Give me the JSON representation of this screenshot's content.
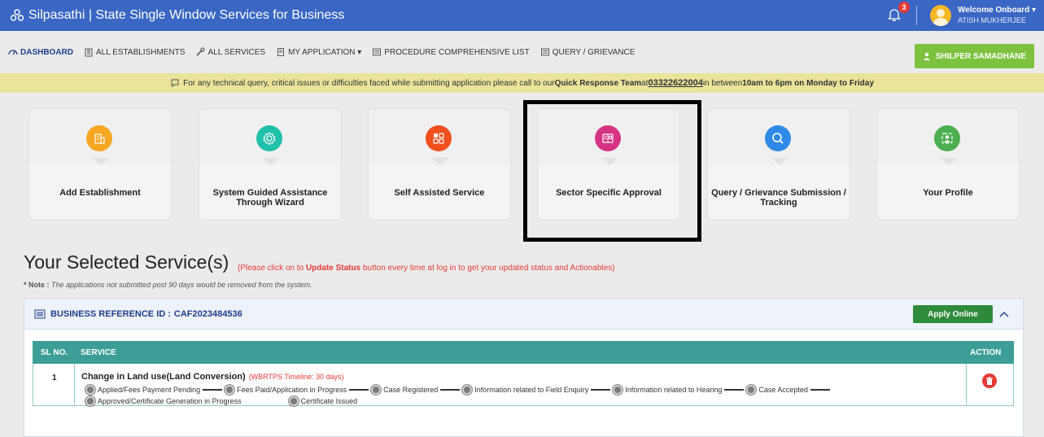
{
  "header": {
    "title": "Silpasathi | State Single Window Services for Business",
    "notification_count": "3",
    "welcome": "Welcome Onboard",
    "user_name": "ATISH MUKHERJEE"
  },
  "nav": {
    "items": [
      {
        "label": "DASHBOARD",
        "icon": "dashboard-icon"
      },
      {
        "label": "ALL ESTABLISHMENTS",
        "icon": "building-icon"
      },
      {
        "label": "ALL SERVICES",
        "icon": "tools-icon"
      },
      {
        "label": "MY APPLICATION",
        "icon": "document-icon"
      },
      {
        "label": "PROCEDURE COMPREHENSIVE LIST",
        "icon": "list-icon"
      },
      {
        "label": "QUERY / GRIEVANCE",
        "icon": "list-icon"
      }
    ],
    "samadhane_label": "SHILPER SAMADHANE"
  },
  "notice": {
    "text1": "For any technical query, critical issues or difficulties faced while submitting application please call to our ",
    "team": "Quick Response Team",
    "text2": " at ",
    "phone": "03322622004 ",
    "text3": " in between ",
    "hours": "10am to 6pm on Monday to Friday"
  },
  "cards": [
    {
      "label": "Add Establishment",
      "icon": "building-icon",
      "color": "#f5a623"
    },
    {
      "label": "System Guided Assistance Through Wizard",
      "icon": "gear-icon",
      "color": "#1fc0a8"
    },
    {
      "label": "Self Assisted Service",
      "icon": "grid-icon",
      "color": "#f0501e"
    },
    {
      "label": "Sector Specific Approval",
      "icon": "book-icon",
      "color": "#d63384"
    },
    {
      "label": "Query / Grievance Submission / Tracking",
      "icon": "search-icon",
      "color": "#2f89e6"
    },
    {
      "label": "Your Profile",
      "icon": "profile-icon",
      "color": "#4caf50"
    }
  ],
  "selected": {
    "title": "Your Selected Service(s)",
    "hint_pre": "(Please click on to ",
    "hint_bold": "Update Status",
    "hint_post": " button every time at log in to get your updated status and Actionables)",
    "note_label": "* Note :",
    "note_text": " The applications not submitted post 90 days would be removed from the system."
  },
  "panel": {
    "ref_label": "BUSINESS REFERENCE ID :",
    "ref_id": "CAF2023484536",
    "apply_label": "Apply Online"
  },
  "table": {
    "headers": {
      "sl": "SL NO.",
      "service": "SERVICE",
      "action": "ACTION"
    },
    "rows": [
      {
        "sl": "1",
        "service": "Change in Land use(Land Conversion)",
        "timeline": "(WBRTPS Timeline: 30 days)",
        "steps": [
          "Applied/Fees Payment Pending",
          "Fees Paid/Application in Progress",
          "Case Registered",
          "Information related to Field Enquiry",
          "Information related to Hearing",
          "Case Accepted",
          "Approved/Certificate Generation in Progress",
          "Certificate Issued"
        ]
      }
    ]
  }
}
